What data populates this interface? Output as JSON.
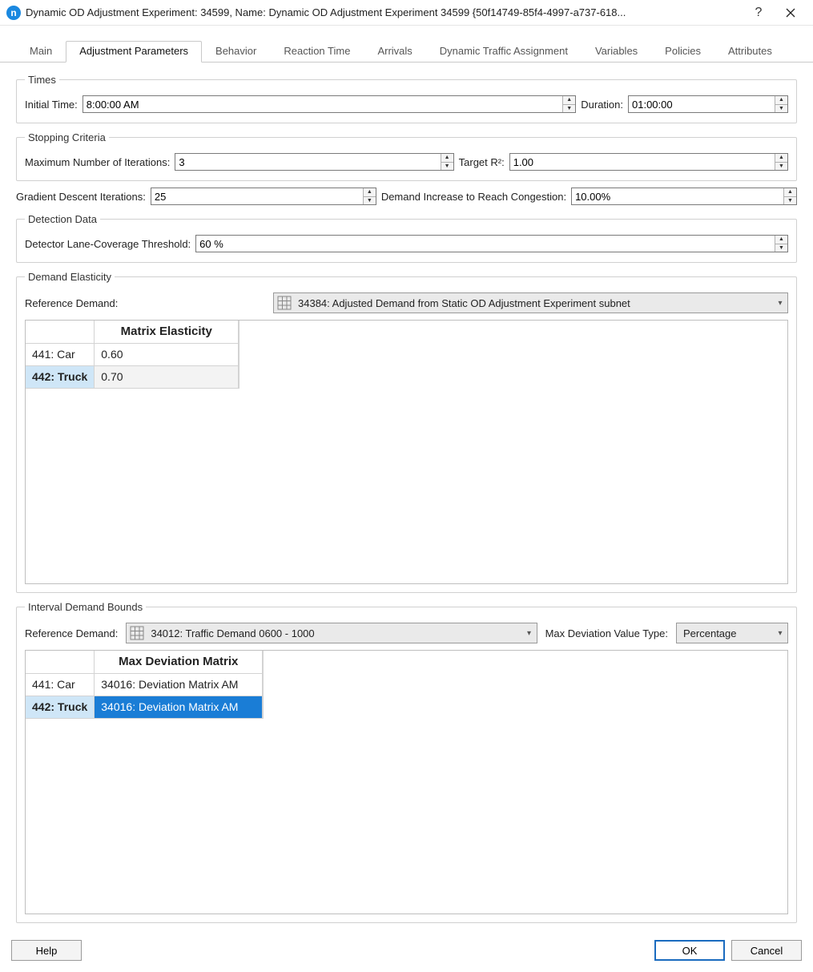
{
  "window": {
    "title": "Dynamic OD Adjustment Experiment: 34599, Name: Dynamic OD Adjustment Experiment 34599  {50f14749-85f4-4997-a737-618...",
    "help_symbol": "?",
    "close_symbol": "✕"
  },
  "tabs": [
    "Main",
    "Adjustment Parameters",
    "Behavior",
    "Reaction Time",
    "Arrivals",
    "Dynamic Traffic Assignment",
    "Variables",
    "Policies",
    "Attributes"
  ],
  "active_tab_index": 1,
  "times": {
    "legend": "Times",
    "initial_time_label": "Initial Time:",
    "initial_time_value": "8:00:00 AM",
    "duration_label": "Duration:",
    "duration_value": "01:00:00"
  },
  "stopping": {
    "legend": "Stopping Criteria",
    "max_iter_label": "Maximum Number of Iterations:",
    "max_iter_value": "3",
    "target_r2_label": "Target R²:",
    "target_r2_value": "1.00"
  },
  "gradient": {
    "gdi_label": "Gradient Descent Iterations:",
    "gdi_value": "25",
    "dirc_label": "Demand Increase to Reach Congestion:",
    "dirc_value": "10.00%"
  },
  "detection": {
    "legend": "Detection Data",
    "threshold_label": "Detector Lane-Coverage Threshold:",
    "threshold_value": "60 %"
  },
  "elasticity": {
    "legend": "Demand Elasticity",
    "ref_label": "Reference Demand:",
    "ref_value": "34384: Adjusted Demand from Static OD Adjustment Experiment subnet",
    "col_header": "Matrix Elasticity",
    "rows": [
      {
        "name": "441: Car",
        "value": "0.60",
        "selected": false
      },
      {
        "name": "442: Truck",
        "value": "0.70",
        "selected": true
      }
    ]
  },
  "bounds": {
    "legend": "Interval Demand Bounds",
    "ref_label": "Reference Demand:",
    "ref_value": "34012: Traffic Demand 0600 - 1000",
    "max_dev_type_label": "Max Deviation Value Type:",
    "max_dev_type_value": "Percentage",
    "col_header": "Max Deviation Matrix",
    "rows": [
      {
        "name": "441: Car",
        "value": "34016: Deviation Matrix AM",
        "selected": false
      },
      {
        "name": "442: Truck",
        "value": "34016: Deviation Matrix AM",
        "selected": true
      }
    ]
  },
  "footer": {
    "help": "Help",
    "ok": "OK",
    "cancel": "Cancel"
  }
}
